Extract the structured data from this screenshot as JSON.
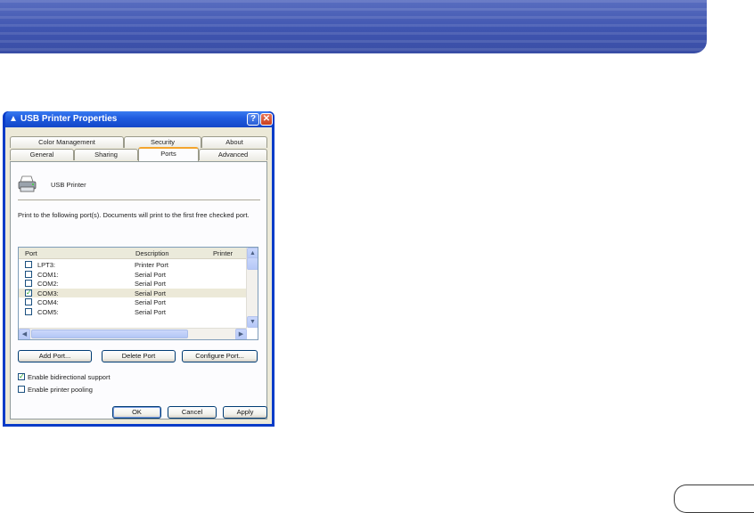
{
  "colors": {
    "banner": "#3f55b0",
    "titlebar": "#1f5ce0",
    "dialog_face": "#ece9d8",
    "active_tab_accent": "#f4a52d"
  },
  "dialog": {
    "title": "USB Printer Properties",
    "help_glyph": "?",
    "close_glyph": "✕",
    "tabs_row_back": [
      "Color Management",
      "Security",
      "About"
    ],
    "tabs_row_front": [
      "General",
      "Sharing",
      "Ports",
      "Advanced"
    ],
    "active_tab": "Ports",
    "printer_name": "USB Printer",
    "instructions": "Print to the following port(s). Documents will print to the first free checked port.",
    "list": {
      "headers": [
        "Port",
        "Description",
        "Printer"
      ],
      "rows": [
        {
          "port": "LPT3:",
          "description": "Printer Port",
          "checked": false
        },
        {
          "port": "COM1:",
          "description": "Serial Port",
          "checked": false
        },
        {
          "port": "COM2:",
          "description": "Serial Port",
          "checked": false
        },
        {
          "port": "COM3:",
          "description": "Serial Port",
          "checked": true
        },
        {
          "port": "COM4:",
          "description": "Serial Port",
          "checked": false
        },
        {
          "port": "COM5:",
          "description": "Serial Port",
          "checked": false
        }
      ]
    },
    "buttons": {
      "add_port": "Add Port...",
      "delete_port": "Delete Port",
      "configure_port": "Configure Port..."
    },
    "options": {
      "bidirectional": {
        "label": "Enable bidirectional support",
        "checked": true
      },
      "pooling": {
        "label": "Enable printer pooling",
        "checked": false
      }
    },
    "footer": {
      "ok": "OK",
      "cancel": "Cancel",
      "apply": "Apply"
    }
  }
}
